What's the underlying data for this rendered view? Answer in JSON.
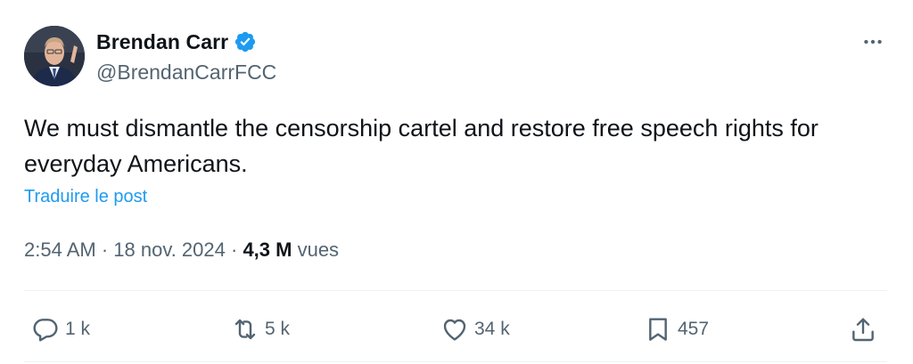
{
  "author": {
    "display_name": "Brendan Carr",
    "handle": "@BrendanCarrFCC",
    "verified": true
  },
  "tweet": {
    "text": "We must dismantle the censorship cartel and restore free speech rights for everyday Americans.",
    "translate_label": "Traduire le post",
    "time": "2:54 AM",
    "separator": " · ",
    "date": "18 nov. 2024",
    "views_count": "4,3 M",
    "views_label": " vues"
  },
  "actions": {
    "replies": "1 k",
    "reposts": "5 k",
    "likes": "34 k",
    "bookmarks": "457"
  },
  "colors": {
    "accent": "#1d9bf0",
    "text": "#0f1419",
    "secondary": "#536471",
    "divider": "#eff3f4"
  },
  "icons": [
    "verified-badge-icon",
    "more-icon",
    "reply-icon",
    "repost-icon",
    "like-icon",
    "bookmark-icon",
    "share-icon"
  ]
}
